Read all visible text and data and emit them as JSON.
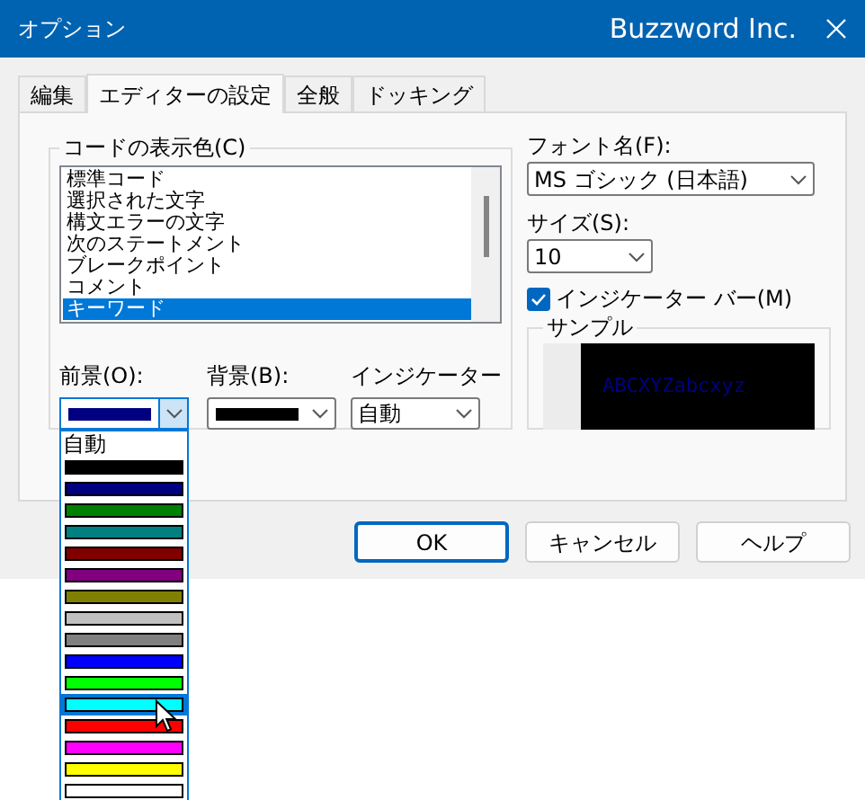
{
  "window": {
    "title": "オプション",
    "brand": "Buzzword Inc."
  },
  "tabs": [
    {
      "label": "編集",
      "selected": false
    },
    {
      "label": "エディターの設定",
      "selected": true
    },
    {
      "label": "全般",
      "selected": false
    },
    {
      "label": "ドッキング",
      "selected": false
    }
  ],
  "code_colors": {
    "label": "コードの表示色(C)",
    "items": [
      {
        "label": "標準コード",
        "selected": false
      },
      {
        "label": "選択された文字",
        "selected": false
      },
      {
        "label": "構文エラーの文字",
        "selected": false
      },
      {
        "label": "次のステートメント",
        "selected": false
      },
      {
        "label": "ブレークポイント",
        "selected": false
      },
      {
        "label": "コメント",
        "selected": false
      },
      {
        "label": "キーワード",
        "selected": true
      }
    ]
  },
  "foreground": {
    "label": "前景(O):",
    "color": "#000080",
    "expanded": true,
    "options": [
      {
        "kind": "text",
        "label": "自動",
        "selected": false
      },
      {
        "kind": "swatch",
        "color": "#000000",
        "selected": false
      },
      {
        "kind": "swatch",
        "color": "#000080",
        "selected": false
      },
      {
        "kind": "swatch",
        "color": "#008000",
        "selected": false
      },
      {
        "kind": "swatch",
        "color": "#008080",
        "selected": false
      },
      {
        "kind": "swatch",
        "color": "#800000",
        "selected": false
      },
      {
        "kind": "swatch",
        "color": "#800080",
        "selected": false
      },
      {
        "kind": "swatch",
        "color": "#808000",
        "selected": false
      },
      {
        "kind": "swatch",
        "color": "#c0c0c0",
        "selected": false
      },
      {
        "kind": "swatch",
        "color": "#808080",
        "selected": false
      },
      {
        "kind": "swatch",
        "color": "#0000ff",
        "selected": false
      },
      {
        "kind": "swatch",
        "color": "#00ff00",
        "selected": false
      },
      {
        "kind": "swatch",
        "color": "#00ffff",
        "selected": true
      },
      {
        "kind": "swatch",
        "color": "#ff0000",
        "selected": false
      },
      {
        "kind": "swatch",
        "color": "#ff00ff",
        "selected": false
      },
      {
        "kind": "swatch",
        "color": "#ffff00",
        "selected": false
      },
      {
        "kind": "swatch",
        "color": "#ffffff",
        "selected": false
      }
    ]
  },
  "background": {
    "label": "背景(B):",
    "color": "#000000"
  },
  "indicator": {
    "label": "インジケーター",
    "value": "自動"
  },
  "font": {
    "label": "フォント名(F):",
    "value": "MS ゴシック (日本語)"
  },
  "size": {
    "label": "サイズ(S):",
    "value": "10"
  },
  "indicator_bar": {
    "label": "インジケーター バー(M)",
    "checked": true
  },
  "sample": {
    "label": "サンプル",
    "text": "ABCXYZabcxyz",
    "color": "#000080"
  },
  "buttons": [
    {
      "label": "OK",
      "default": true
    },
    {
      "label": "キャンセル",
      "default": false
    },
    {
      "label": "ヘルプ",
      "default": false
    }
  ]
}
